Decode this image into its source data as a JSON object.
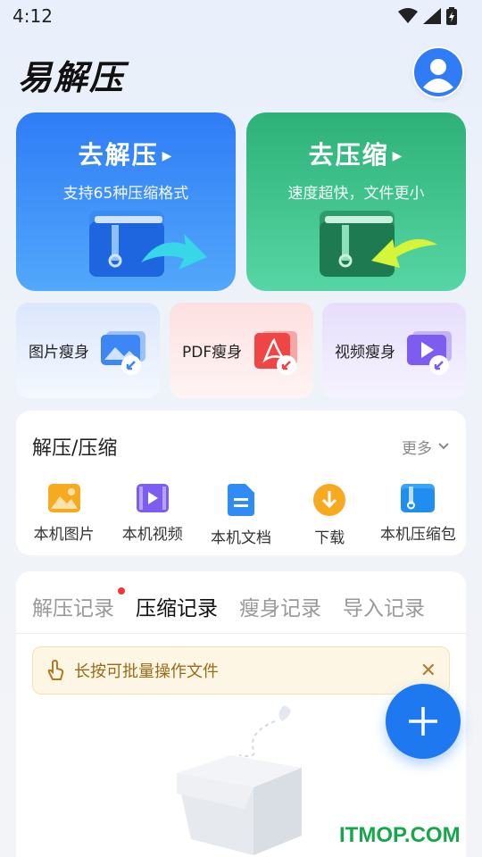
{
  "status": {
    "time": "4:12"
  },
  "app": {
    "title": "易解压"
  },
  "cards": {
    "unzip": {
      "title": "去解压",
      "subtitle": "支持65种压缩格式"
    },
    "zip": {
      "title": "去压缩",
      "subtitle": "速度超快，文件更小"
    }
  },
  "slim": [
    {
      "label": "图片瘦身"
    },
    {
      "label": "PDF瘦身"
    },
    {
      "label": "视频瘦身"
    }
  ],
  "tools": {
    "title": "解压/压缩",
    "more": "更多",
    "items": [
      {
        "label": "本机图片",
        "icon": "image-icon"
      },
      {
        "label": "本机视频",
        "icon": "video-icon"
      },
      {
        "label": "本机文档",
        "icon": "document-icon"
      },
      {
        "label": "下载",
        "icon": "download-icon"
      },
      {
        "label": "本机压缩包",
        "icon": "archive-icon"
      }
    ]
  },
  "records": {
    "tabs": [
      {
        "label": "解压记录"
      },
      {
        "label": "压缩记录"
      },
      {
        "label": "瘦身记录"
      },
      {
        "label": "导入记录"
      }
    ],
    "active_tab": "压缩记录",
    "tip": "长按可批量操作文件"
  },
  "watermark": "ITMOP.COM",
  "colors": {
    "unzip_card": "#2f7cf6",
    "zip_card": "#2eb178",
    "fab": "#1e78f0",
    "tip_bg": "#fdf6e4"
  }
}
